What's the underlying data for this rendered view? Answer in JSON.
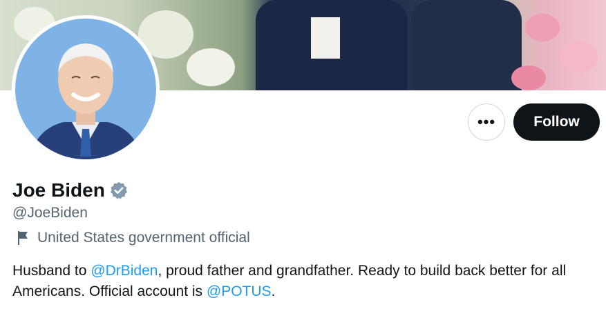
{
  "banner": {
    "icon": "banner-photo"
  },
  "avatar": {
    "icon": "profile-photo"
  },
  "actions": {
    "more_label": "•••",
    "follow_label": "Follow"
  },
  "profile": {
    "display_name": "Joe Biden",
    "verified_icon": "verified-badge-icon",
    "handle": "@JoeBiden",
    "affiliation_icon": "flag-icon",
    "affiliation": "United States government official",
    "bio": {
      "part1": "Husband to ",
      "mention1": "@DrBiden",
      "part2": ", proud father and grandfather. Ready to build back better for all Americans. Official account is ",
      "mention2": "@POTUS",
      "part3": "."
    }
  },
  "colors": {
    "text": "#0f1419",
    "secondary": "#536471",
    "link": "#1d9bf0",
    "follow_bg": "#0f1419",
    "verified": "#829aab"
  }
}
